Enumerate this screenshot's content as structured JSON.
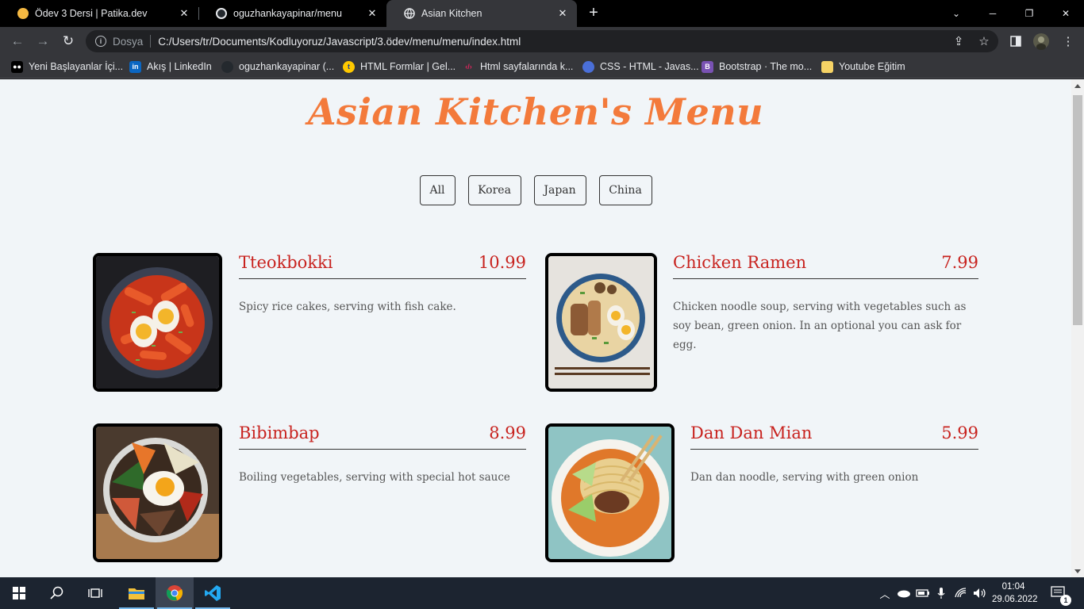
{
  "browser": {
    "tabs": [
      {
        "title": "Ödev 3 Dersi | Patika.dev",
        "icon": "patika-icon",
        "active": false
      },
      {
        "title": "oguzhankayapinar/menu",
        "icon": "github-icon",
        "active": false
      },
      {
        "title": "Asian Kitchen",
        "icon": "globe-icon",
        "active": true
      }
    ],
    "omnibox": {
      "scheme_label": "Dosya",
      "url": "C:/Users/tr/Documents/Kodluyoruz/Javascript/3.ödev/menu/menu/index.html"
    },
    "bookmarks": [
      {
        "label": "Yeni Başlayanlar İçi...",
        "icon": "medium-icon",
        "color": "#000000"
      },
      {
        "label": "Akış | LinkedIn",
        "icon": "linkedin-icon",
        "color": "#0a66c2"
      },
      {
        "label": "oguzhankayapinar (...",
        "icon": "github-icon",
        "color": "#24292e"
      },
      {
        "label": "HTML Formlar | Gel...",
        "icon": "turkcell-icon",
        "color": "#ffc900"
      },
      {
        "label": "Html sayfalarında k...",
        "icon": "code-icon",
        "color": "#e0245e"
      },
      {
        "label": "CSS - HTML - Javas...",
        "icon": "bootstrap-icon",
        "color": "#6f42c1"
      },
      {
        "label": "Bootstrap · The mo...",
        "icon": "bootstrap-b-icon",
        "color": "#7952b3"
      },
      {
        "label": "Youtube Eğitim",
        "icon": "folder-icon",
        "color": "#f6d365"
      }
    ]
  },
  "page": {
    "title": "Asian Kitchen's Menu",
    "filters": [
      "All",
      "Korea",
      "Japan",
      "China"
    ],
    "items": [
      {
        "name": "Tteokbokki",
        "price": "10.99",
        "desc": "Spicy rice cakes, serving with fish cake.",
        "photo": "tteokbokki-photo"
      },
      {
        "name": "Chicken Ramen",
        "price": "7.99",
        "desc": "Chicken noodle soup, serving with vegetables such as soy bean, green onion. In an optional you can ask for egg.",
        "photo": "chicken-ramen-photo"
      },
      {
        "name": "Bibimbap",
        "price": "8.99",
        "desc": "Boiling vegetables, serving with special hot sauce",
        "photo": "bibimbap-photo"
      },
      {
        "name": "Dan Dan Mian",
        "price": "5.99",
        "desc": "Dan dan noodle, serving with green onion",
        "photo": "dan-dan-mian-photo"
      }
    ]
  },
  "colors": {
    "title": "#f37a3b",
    "item_text": "#c8231f",
    "page_bg": "#f1f5f8"
  },
  "taskbar": {
    "time": "01:04",
    "date": "29.06.2022",
    "notifications": "1"
  }
}
